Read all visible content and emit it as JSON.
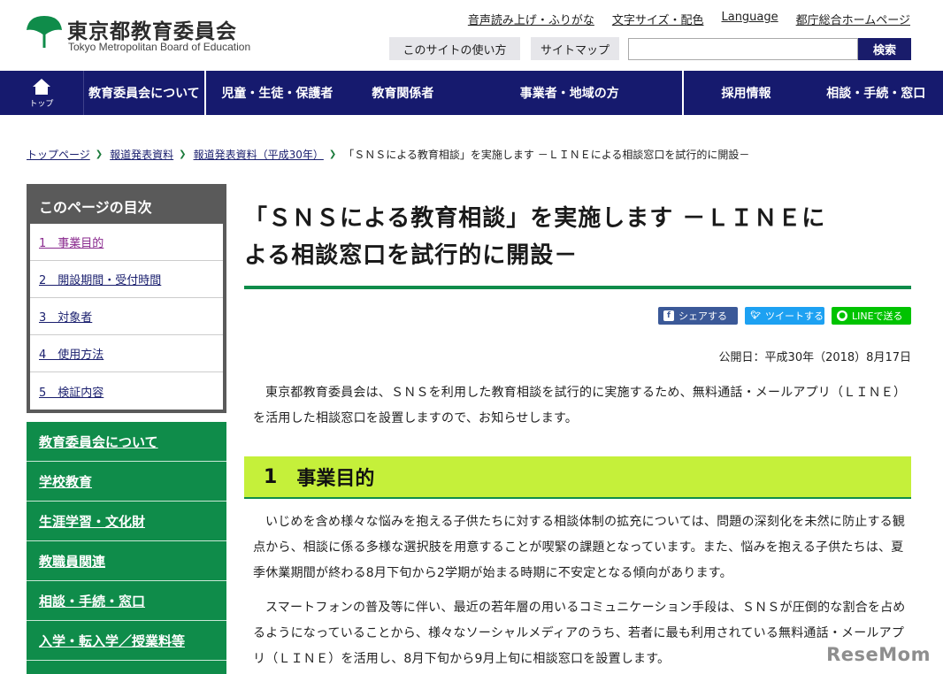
{
  "header": {
    "logo_jp": "東京都教育委員会",
    "logo_en": "Tokyo Metropolitan Board of Education",
    "top_links": [
      "音声読み上げ・ふりがな",
      "文字サイズ・配色",
      "Language",
      "都庁総合ホームページ"
    ],
    "usage_btn": "このサイトの使い方",
    "sitemap_btn": "サイトマップ",
    "search_value": "",
    "search_btn": "検索"
  },
  "nav": {
    "home_label": "トップ",
    "items": [
      "教育委員会について",
      "児童・生徒・保護者",
      "教育関係者",
      "事業者・地域の方",
      "採用情報",
      "相談・手続・窓口"
    ]
  },
  "breadcrumb": {
    "items": [
      "トップページ",
      "報道発表資料",
      "報道発表資料（平成30年）"
    ],
    "current": "「ＳＮＳによる教育相談」を実施します －ＬＩＮＥによる相談窓口を試行的に開設－"
  },
  "toc": {
    "title": "このページの目次",
    "items": [
      "1　事業目的",
      "2　開設期間・受付時間",
      "3　対象者",
      "4　使用方法",
      "5　検証内容"
    ]
  },
  "sidemenu": {
    "items": [
      "教育委員会について",
      "学校教育",
      "生涯学習・文化財",
      "教職員関連",
      "相談・手続・窓口",
      "入学・転入学／授業料等"
    ]
  },
  "main": {
    "title_line1": "「ＳＮＳによる教育相談」を実施します －ＬＩＮＥに",
    "title_line2": "よる相談窓口を試行的に開設－",
    "share": {
      "facebook": "シェアする",
      "twitter": "ツイートする",
      "line": "LINEで送る"
    },
    "pubdate": "公開日：平成30年（2018）8月17日",
    "intro": "東京都教育委員会は、ＳＮＳを利用した教育相談を試行的に実施するため、無料通話・メールアプリ（ＬＩＮＥ）を活用した相談窓口を設置しますので、お知らせします。",
    "section1": {
      "num": "1",
      "title": "事業目的",
      "para1": "いじめを含め様々な悩みを抱える子供たちに対する相談体制の拡充については、問題の深刻化を未然に防止する観点から、相談に係る多様な選択肢を用意することが喫緊の課題となっています。また、悩みを抱える子供たちは、夏季休業期間が終わる8月下旬から2学期が始まる時期に不安定となる傾向があります。",
      "para2": "スマートフォンの普及等に伴い、最近の若年層の用いるコミュニケーション手段は、ＳＮＳが圧倒的な割合を占めるようになっていることから、様々なソーシャルメディアのうち、若者に最も利用されている無料通話・メールアプリ（ＬＩＮＥ）を活用し、8月下旬から9月上旬に相談窓口を設置します。"
    }
  },
  "watermark": "ReseMom",
  "colors": {
    "nav_bg": "#161a6e",
    "green": "#0f8c4a",
    "lime": "#c5f03a",
    "facebook": "#3b5998",
    "twitter": "#1da1f2",
    "line": "#00c300"
  }
}
